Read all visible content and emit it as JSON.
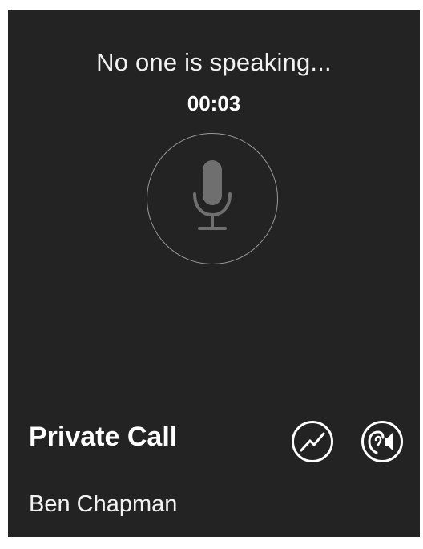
{
  "call": {
    "status": "No one is speaking...",
    "timer": "00:03",
    "type": "Private Call",
    "caller": "Ben Chapman"
  },
  "controls": {
    "microphone": "microphone-icon",
    "signal": "signal-graph-icon",
    "speaker": "earpiece-speaker-icon"
  },
  "colors": {
    "background": "#232323",
    "text": "#ffffff",
    "mic_ring": "#9a9a9a",
    "mic_icon": "#6f6f6f"
  }
}
